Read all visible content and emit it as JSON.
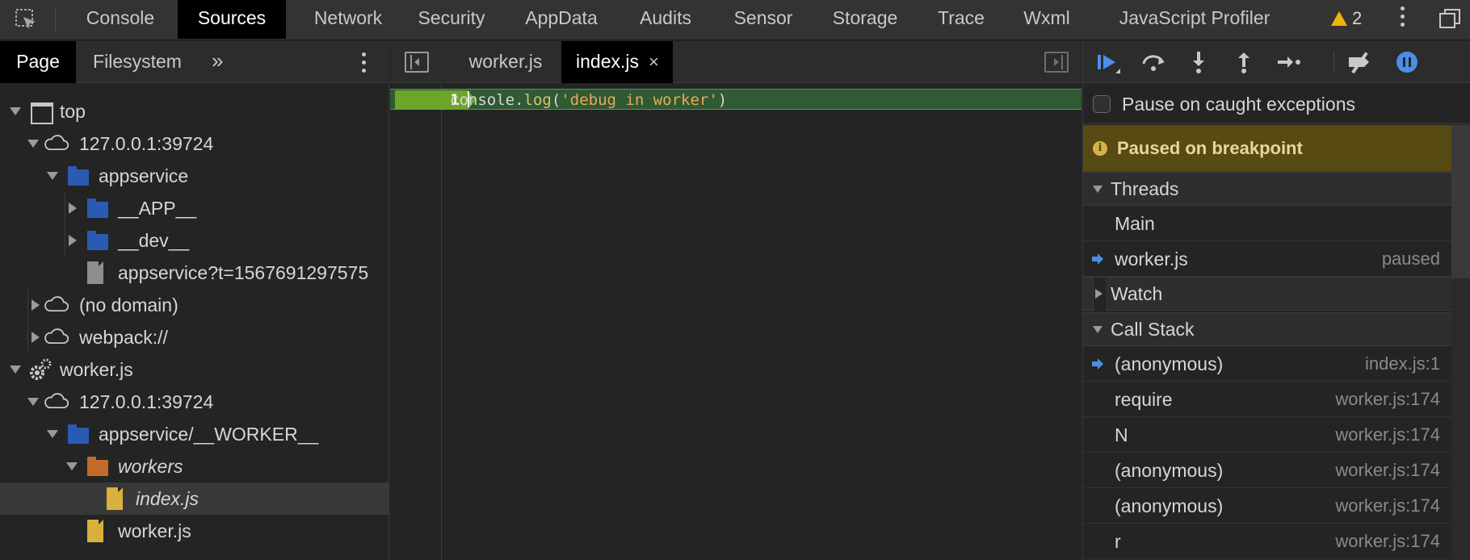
{
  "top_tabs": [
    {
      "label": "Console",
      "active": false
    },
    {
      "label": "Sources",
      "active": true
    },
    {
      "label": "Network",
      "active": false
    },
    {
      "label": "Security",
      "active": false
    },
    {
      "label": "AppData",
      "active": false
    },
    {
      "label": "Audits",
      "active": false
    },
    {
      "label": "Sensor",
      "active": false
    },
    {
      "label": "Storage",
      "active": false
    },
    {
      "label": "Trace",
      "active": false
    },
    {
      "label": "Wxml",
      "active": false
    },
    {
      "label": "JavaScript Profiler",
      "active": false
    }
  ],
  "warnings": {
    "count": "2"
  },
  "navigator": {
    "tabs": [
      {
        "label": "Page",
        "active": true
      },
      {
        "label": "Filesystem",
        "active": false
      }
    ],
    "more": "»",
    "tree": [
      {
        "label": "top"
      },
      {
        "label": "127.0.0.1:39724"
      },
      {
        "label": "appservice"
      },
      {
        "label": "__APP__"
      },
      {
        "label": "__dev__"
      },
      {
        "label": "appservice?t=1567691297575"
      },
      {
        "label": "(no domain)"
      },
      {
        "label": "webpack://"
      },
      {
        "label": "worker.js"
      },
      {
        "label": "127.0.0.1:39724"
      },
      {
        "label": "appservice/__WORKER__"
      },
      {
        "label": "workers"
      },
      {
        "label": "index.js"
      },
      {
        "label": "worker.js"
      }
    ]
  },
  "editor": {
    "tabs": [
      {
        "label": "worker.js",
        "active": false
      },
      {
        "label": "index.js",
        "active": true,
        "close": "×"
      }
    ],
    "line_number": "1",
    "code": {
      "obj_a": "co",
      "obj_b": "nsole",
      "dot": ".",
      "fn": "log",
      "open": "(",
      "str": "'debug in worker'",
      "close": ")"
    }
  },
  "debugger": {
    "pause_on_caught": "Pause on caught exceptions",
    "paused_message": "Paused on breakpoint",
    "info_glyph": "i",
    "threads_label": "Threads",
    "threads": [
      {
        "name": "Main",
        "status": "",
        "current": false
      },
      {
        "name": "worker.js",
        "status": "paused",
        "current": true
      }
    ],
    "watch_label": "Watch",
    "call_stack_label": "Call Stack",
    "call_stack": [
      {
        "name": "(anonymous)",
        "location": "index.js:1",
        "current": true
      },
      {
        "name": "require",
        "location": "worker.js:174",
        "current": false
      },
      {
        "name": "N",
        "location": "worker.js:174",
        "current": false
      },
      {
        "name": "(anonymous)",
        "location": "worker.js:174",
        "current": false
      },
      {
        "name": "(anonymous)",
        "location": "worker.js:174",
        "current": false
      },
      {
        "name": "r",
        "location": "worker.js:174",
        "current": false
      }
    ]
  },
  "colors": {
    "accent": "#4a8fe8",
    "breakpoint": "#6aa62a",
    "paused_banner": "#574a12",
    "warning": "#f0b400"
  }
}
